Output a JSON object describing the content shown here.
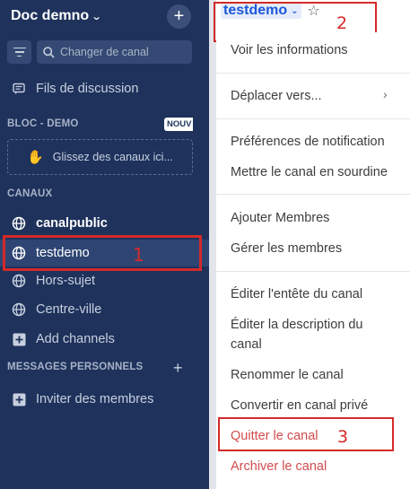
{
  "sidebar": {
    "team_name": "Doc demno",
    "search_placeholder": "Changer de canal",
    "threads_label": "Fils de discussion",
    "block_section": {
      "title": "BLOC - DEMO",
      "badge": "NOUV",
      "drop_hint": "Glissez des canaux ici..."
    },
    "channels_section": {
      "title": "CANAUX",
      "items": [
        {
          "label": "canalpublic",
          "state": "unread"
        },
        {
          "label": "testdemo",
          "state": "selected"
        },
        {
          "label": "Hors-sujet",
          "state": "normal"
        },
        {
          "label": "Centre-ville",
          "state": "normal"
        }
      ],
      "add_label": "Add channels"
    },
    "dm_section": {
      "title": "MESSAGES PERSONNELS"
    },
    "invite_label": "Inviter des membres"
  },
  "header": {
    "channel_name": "testdemo"
  },
  "menu": {
    "view_info": "Voir les informations",
    "move_to": "Déplacer vers...",
    "notif_prefs": "Préférences de notification",
    "mute": "Mettre le canal en sourdine",
    "add_members": "Ajouter Membres",
    "manage_members": "Gérer les membres",
    "edit_header": "Éditer l'entête du canal",
    "edit_purpose": "Éditer la description du canal",
    "rename": "Renommer le canal",
    "convert_private": "Convertir en canal privé",
    "leave": "Quitter le canal",
    "archive": "Archiver le canal"
  },
  "annotations": {
    "one": "1",
    "two": "2",
    "three": "3"
  },
  "colors": {
    "sidebar_bg": "#1e325c",
    "accent": "#1c58d9",
    "danger": "#d24b4e",
    "annotation": "#d42a2a"
  }
}
